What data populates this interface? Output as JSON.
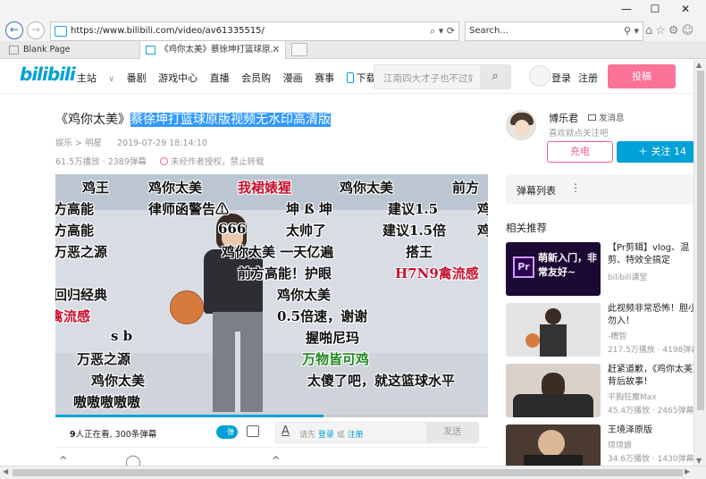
{
  "browser": {
    "url": "https://www.bilibili.com/video/av61335515/",
    "search_placeholder": "Search...",
    "tabs": [
      {
        "label": "Blank Page"
      },
      {
        "label": "《鸡你太美》蔡徐坤打篮球原..."
      }
    ],
    "window_controls": {
      "minimize": "—",
      "maximize": "☐",
      "close": "✕"
    }
  },
  "site": {
    "logo": "bilibili",
    "nav": [
      "主站",
      "番剧",
      "游戏中心",
      "直播",
      "会员购",
      "漫画",
      "赛事",
      "下载APP"
    ],
    "search_placeholder": "江南四大才子也不过如此",
    "login": "登录",
    "register": "注册",
    "upload": "投稿"
  },
  "video": {
    "title_prefix": "《鸡你太美》",
    "title_selected": "蔡徐坤打篮球原版视频无水印高清版",
    "breadcrumb": "娱乐 > 明星",
    "date": "2019-07-29 18:14:10",
    "plays": "61.5万播放",
    "danmaku_count": "2389弹幕",
    "notice": "未经作者授权，禁止转载",
    "progress": 0.62
  },
  "uploader": {
    "name": "博乐君",
    "message": "发消息",
    "description": "喜欢就点关注吧",
    "charge": "充电",
    "follow": "关注 14"
  },
  "danmaku": [
    {
      "text": "鸡王",
      "color": "black"
    },
    {
      "text": "鸡你太美",
      "color": "black"
    },
    {
      "text": "鸡你太美",
      "color": "black"
    },
    {
      "text": "前方",
      "color": "black"
    },
    {
      "text": "方高能",
      "color": "black"
    },
    {
      "text": "律师函警告⚠",
      "color": "black"
    },
    {
      "text": "坤 ß 坤",
      "color": "black"
    },
    {
      "text": "建议1.5",
      "color": "black"
    },
    {
      "text": "鸡",
      "color": "black"
    },
    {
      "text": "方高能",
      "color": "black"
    },
    {
      "text": "666",
      "color": "black"
    },
    {
      "text": "太帅了",
      "color": "black"
    },
    {
      "text": "建议1.5倍",
      "color": "black"
    },
    {
      "text": "鸡",
      "color": "black"
    },
    {
      "text": "万恶之源",
      "color": "black"
    },
    {
      "text": "鸡你太美 一天亿遍",
      "color": "black"
    },
    {
      "text": "搭王",
      "color": "black"
    },
    {
      "text": "前方高能！护眼",
      "color": "black"
    },
    {
      "text": "H7N9禽流感",
      "color": "red"
    },
    {
      "text": "回归经典",
      "color": "black"
    },
    {
      "text": "鸡你太美",
      "color": "black"
    },
    {
      "text": "禽流感",
      "color": "red"
    },
    {
      "text": "0.5倍速，谢谢",
      "color": "black"
    },
    {
      "text": "s b",
      "color": "black"
    },
    {
      "text": "握啪尼玛",
      "color": "black"
    },
    {
      "text": "万恶之源",
      "color": "black"
    },
    {
      "text": "万物皆可鸡",
      "color": "green"
    },
    {
      "text": "鸡你太美",
      "color": "black"
    },
    {
      "text": "太傻了吧，就这篮球水平",
      "color": "black"
    },
    {
      "text": "嗷嗷嗷嗷嗷",
      "color": "black"
    },
    {
      "text": "我裙婊猩",
      "color": "red"
    }
  ],
  "sendbar": {
    "viewers_num": "9",
    "viewers_text": "人正在看, 300条弹幕",
    "toggle_label": "弹",
    "hint_prefix": "请先",
    "hint_login": "登录",
    "hint_or": "或",
    "hint_register": "注册",
    "send": "发送"
  },
  "sidebar": {
    "danmaku_list": "弹幕列表",
    "related_title": "相关推荐",
    "related": [
      {
        "title": "【Pr剪辑】vlog、混剪、特效全搞定",
        "author": "bilibili课堂",
        "stats": "",
        "thumb_text": "萌新入门，非常友好~"
      },
      {
        "title": "此视频非常恐怖！胆小勿入！",
        "author": "-糟智",
        "stats": "217.5万播放 · 4198弹幕",
        "thumb_text": ""
      },
      {
        "title": "赶紧道歉，《鸡你太美》背后故事！",
        "author": "平胸狂魔Max",
        "stats": "45.4万播放 · 2465弹幕",
        "thumb_text": ""
      },
      {
        "title": "王境泽原版",
        "author": "琼琼娘",
        "stats": "34.6万播放 · 1430弹幕",
        "thumb_text": ""
      }
    ]
  }
}
